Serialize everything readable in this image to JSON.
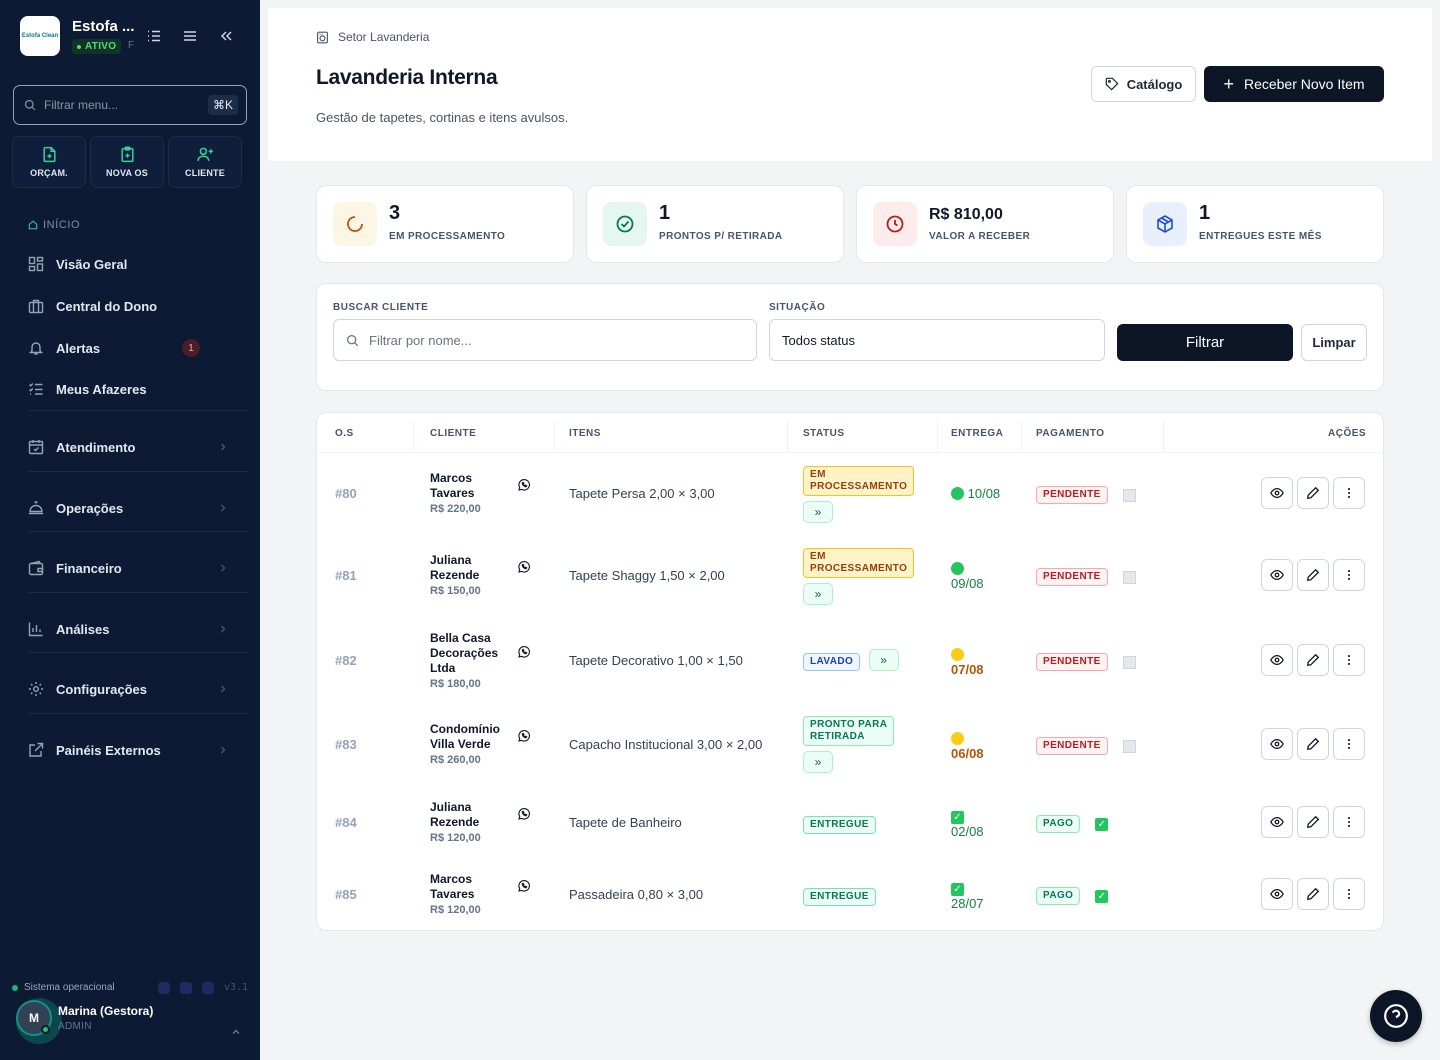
{
  "sidebar": {
    "brand": {
      "name": "Estofa ...",
      "status": "ATIVO",
      "extra": "F",
      "logo_text": "Estofa Clean"
    },
    "search": {
      "placeholder": "Filtrar menu...",
      "shortcut": "⌘K"
    },
    "quick_actions": [
      {
        "label": "ORÇAM.",
        "icon": "file-plus-icon"
      },
      {
        "label": "NOVA OS",
        "icon": "clipboard-plus-icon"
      },
      {
        "label": "CLIENTE",
        "icon": "user-plus-icon"
      }
    ],
    "section_inicio": "INÍCIO",
    "items": [
      {
        "label": "Visão Geral",
        "icon": "grid-icon"
      },
      {
        "label": "Central do Dono",
        "icon": "briefcase-icon"
      },
      {
        "label": "Alertas",
        "icon": "bell-icon",
        "badge": "1"
      },
      {
        "label": "Meus Afazeres",
        "icon": "checklist-icon"
      }
    ],
    "groups": [
      {
        "label": "Atendimento",
        "icon": "calendar-icon"
      },
      {
        "label": "Operações",
        "icon": "bell-service-icon"
      },
      {
        "label": "Financeiro",
        "icon": "wallet-icon"
      },
      {
        "label": "Análises",
        "icon": "bar-chart-icon"
      },
      {
        "label": "Configurações",
        "icon": "gear-icon"
      },
      {
        "label": "Painéis Externos",
        "icon": "external-link-icon"
      }
    ],
    "system_status": "Sistema operacional",
    "version": "v3.1",
    "user": {
      "name": "Marina (Gestora)",
      "role": "ADMIN",
      "initial": "M"
    }
  },
  "header": {
    "breadcrumb": "Setor Lavanderia",
    "title": "Lavanderia Interna",
    "subtitle": "Gestão de tapetes, cortinas e itens avulsos.",
    "catalog_label": "Catálogo",
    "new_item_label": "Receber Novo Item"
  },
  "stats": [
    {
      "value": "3",
      "label": "EM PROCESSAMENTO",
      "icon": "loader-icon",
      "color": "#b45309",
      "bg": "#fef6e4"
    },
    {
      "value": "1",
      "label": "PRONTOS P/ RETIRADA",
      "icon": "check-circle-icon",
      "color": "#047857",
      "bg": "#e6f7ef"
    },
    {
      "value": "R$ 810,00",
      "label": "VALOR A RECEBER",
      "icon": "clock-icon",
      "color": "#b91c1c",
      "bg": "#fdecec"
    },
    {
      "value": "1",
      "label": "ENTREGUES ESTE MÊS",
      "icon": "package-icon",
      "color": "#1d4ed8",
      "bg": "#e9f0fd"
    }
  ],
  "filters": {
    "client_label": "BUSCAR CLIENTE",
    "client_placeholder": "Filtrar por nome...",
    "status_label": "SITUAÇÃO",
    "status_value": "Todos status",
    "filter_button": "Filtrar",
    "clear_button": "Limpar"
  },
  "table": {
    "headers": {
      "os": "O.S",
      "client": "CLIENTE",
      "items": "ITENS",
      "status": "STATUS",
      "delivery": "ENTREGA",
      "payment": "PAGAMENTO",
      "actions": "AÇÕES"
    },
    "advance_glyph": "»",
    "rows": [
      {
        "os": "#80",
        "client_l1": "Marcos",
        "client_l2": "Tavares",
        "client_l3": "",
        "price": "R$ 220,00",
        "items": "Tapete Persa 2,00 × 3,00",
        "status_l1": "EM",
        "status_l2": "PROCESSAMENTO",
        "status_type": "proc",
        "delivery": "10/08",
        "payment": "PENDENTE"
      },
      {
        "os": "#81",
        "client_l1": "Juliana",
        "client_l2": "Rezende",
        "client_l3": "",
        "price": "R$ 150,00",
        "items": "Tapete Shaggy 1,50 × 2,00",
        "status_l1": "EM",
        "status_l2": "PROCESSAMENTO",
        "status_type": "proc",
        "delivery": "09/08",
        "payment": "PENDENTE"
      },
      {
        "os": "#82",
        "client_l1": "Bella Casa",
        "client_l2": "Decorações",
        "client_l3": "Ltda",
        "price": "R$ 180,00",
        "items": "Tapete Decorativo 1,00 × 1,50",
        "status_l1": "LAVADO",
        "status_l2": "",
        "status_type": "lav",
        "delivery": "07/08",
        "payment": "PENDENTE"
      },
      {
        "os": "#83",
        "client_l1": "Condomínio",
        "client_l2": "Villa Verde",
        "client_l3": "",
        "price": "R$ 260,00",
        "items": "Capacho Institucional 3,00 × 2,00",
        "status_l1": "PRONTO PARA",
        "status_l2": "RETIRADA",
        "status_type": "ret",
        "delivery": "06/08",
        "payment": "PENDENTE"
      },
      {
        "os": "#84",
        "client_l1": "Juliana",
        "client_l2": "Rezende",
        "client_l3": "",
        "price": "R$ 120,00",
        "items": "Tapete de Banheiro",
        "status_l1": "ENTREGUE",
        "status_l2": "",
        "status_type": "ent",
        "delivery": "02/08",
        "payment": "PAGO"
      },
      {
        "os": "#85",
        "client_l1": "Marcos",
        "client_l2": "Tavares",
        "client_l3": "",
        "price": "R$ 120,00",
        "items": "Passadeira 0,80 × 3,00",
        "status_l1": "ENTREGUE",
        "status_l2": "",
        "status_type": "ent",
        "delivery": "28/07",
        "payment": "PAGO"
      }
    ]
  }
}
